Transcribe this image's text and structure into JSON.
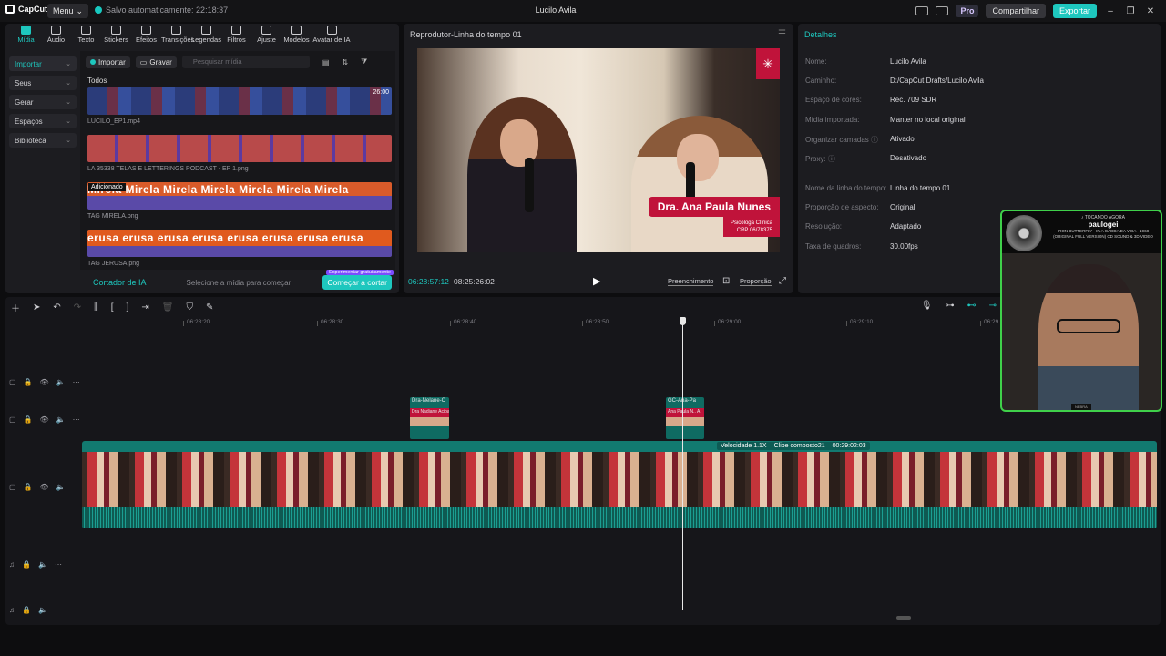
{
  "titlebar": {
    "app_name": "CapCut",
    "menu_label": "Menu",
    "autosave": "Salvo automaticamente: 22:18:37",
    "project_title": "Lucilo Avila",
    "pro_label": "Pro",
    "share_label": "Compartilhar",
    "export_label": "Exportar"
  },
  "tools": [
    "Mídia",
    "Áudio",
    "Texto",
    "Stickers",
    "Efeitos",
    "Transições",
    "Legendas",
    "Filtros",
    "Ajuste",
    "Modelos",
    "Avatar de IA"
  ],
  "side_nav": [
    "Importar",
    "Seus",
    "Gerar",
    "Espaços",
    "Biblioteca"
  ],
  "media": {
    "import_label": "Importar",
    "record_label": "Gravar",
    "search_placeholder": "Pesquisar mídia",
    "section": "Todos",
    "clips": [
      {
        "name": "LUCILO_EP1.mp4",
        "duration": "26:00"
      },
      {
        "name": "LA 35338 TELAS E LETTERINGS PODCAST - EP 1.png"
      },
      {
        "name": "TAG MIRELA.png",
        "badge": "Adicionado",
        "banner": "Mirela Mirela Mirela Mirela Mirela Mirela Mirela"
      },
      {
        "name": "TAG JERUSA.png",
        "banner": "erusa erusa erusa erusa erusa erusa erusa erusa"
      }
    ],
    "ai_cutter": "Cortador de IA",
    "ai_hint": "Selecione a mídia para começar",
    "ai_button": "Começar a cortar",
    "ai_promo": "Experimentar gratuitamente"
  },
  "player": {
    "title": "Reprodutor-Linha do tempo 01",
    "current_time": "06:28:57:12",
    "total_time": "08:25:26:02",
    "fill_label": "Preenchimento",
    "ratio_label": "Proporção",
    "lower_third_name": "Dra. Ana Paula Nunes",
    "lower_third_sub1": "Psicóloga Clínica",
    "lower_third_sub2": "CRP 06/78375"
  },
  "details": {
    "title": "Detalhes",
    "rows": [
      {
        "k": "Nome:",
        "v": "Lucilo Avila"
      },
      {
        "k": "Caminho:",
        "v": "D:/CapCut Drafts/Lucilo Avila"
      },
      {
        "k": "Espaço de cores:",
        "v": "Rec. 709 SDR"
      },
      {
        "k": "Mídia importada:",
        "v": "Manter no local original"
      },
      {
        "k": "Organizar camadas ⓘ",
        "v": "Ativado"
      },
      {
        "k": "Proxy: ⓘ",
        "v": "Desativado"
      },
      {
        "k": "Nome da linha do tempo:",
        "v": "Linha do tempo 01"
      },
      {
        "k": "Proporção de aspecto:",
        "v": "Original"
      },
      {
        "k": "Resolução:",
        "v": "Adaptado"
      },
      {
        "k": "Taxa de quadros:",
        "v": "30.00fps"
      }
    ]
  },
  "webcam": {
    "tag": "♪ TOCANDO AGORA",
    "artist": "paulogei",
    "song": "IRON BUTTERFLY - IN A GADDA DA VIDA - 1968 (ORIGINAL FULL VERSION) CD SOUND & 3D VIDEO",
    "bottom": "NEBRA"
  },
  "timeline": {
    "ruler": [
      "06:28:20",
      "06:28:30",
      "06:28:40",
      "06:28:50",
      "06:29:00",
      "06:29:10",
      "06:29"
    ],
    "gc1_label": "Dra-Nelane-C",
    "gc2_label": "GC-Ana-Pa",
    "gc1_text": "Dra Nadiane Acioa, N",
    "gc2_text": "Ana Paula N.. A",
    "speed": "Velocidade 1.1X",
    "clip_name": "Clipe composto21",
    "clip_dur": "00:29:02:03"
  },
  "colors": {
    "accent": "#1ec7be",
    "lower_third": "#c0133a",
    "clip": "#127a70"
  }
}
